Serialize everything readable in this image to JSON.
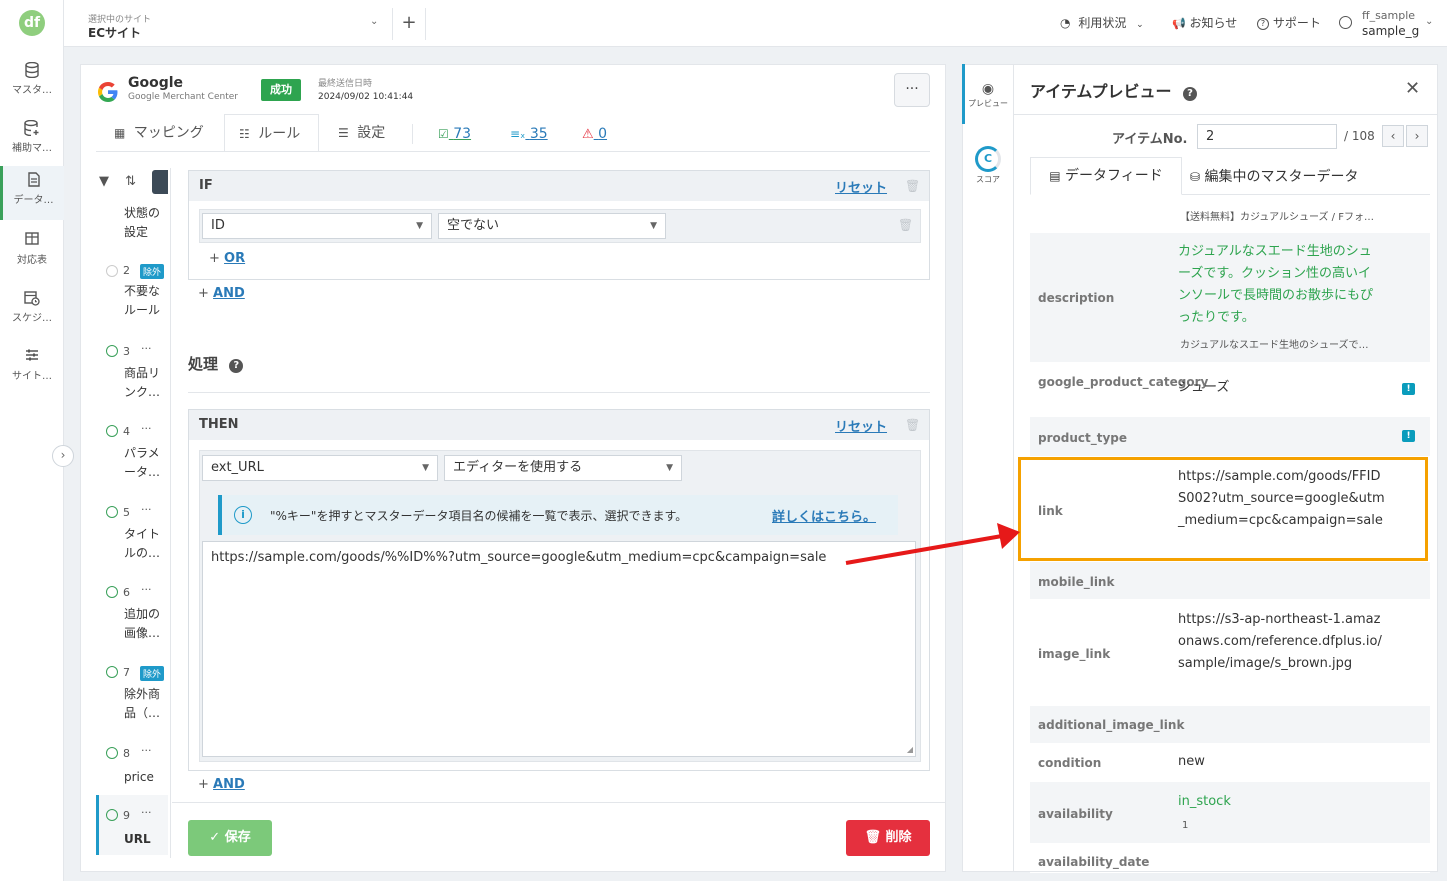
{
  "rail": {
    "logo": "df",
    "items": [
      {
        "label": "マスタ…",
        "icon": "database-icon"
      },
      {
        "label": "補助マ…",
        "icon": "database-plus-icon"
      },
      {
        "label": "データ…",
        "icon": "document-icon"
      },
      {
        "label": "対応表",
        "icon": "table-icon"
      },
      {
        "label": "スケジ…",
        "icon": "calendar-clock-icon"
      },
      {
        "label": "サイト…",
        "icon": "sliders-icon"
      }
    ]
  },
  "header": {
    "site_label": "選択中のサイト",
    "site_name": "ECサイト",
    "usage": "利用状況",
    "news": "お知らせ",
    "support": "サポート",
    "user_id": "ff_sample",
    "user_name": "sample_g"
  },
  "feed": {
    "name": "Google",
    "subtitle": "Google Merchant Center",
    "status": "成功",
    "last_sent_label": "最終送信日時",
    "last_sent": "2024/09/02 10:41:44",
    "more": "···"
  },
  "tabs": {
    "mapping": "マッピング",
    "rules": "ルール",
    "settings": "設定",
    "stat_ok": "73",
    "stat_x": "35",
    "stat_warn": "0"
  },
  "rules": [
    {
      "num": "",
      "name": "状態の設定",
      "tag": ""
    },
    {
      "num": "2",
      "name": "不要なルール",
      "tag": "除外"
    },
    {
      "num": "3",
      "name": "商品リンク…",
      "tag": ""
    },
    {
      "num": "4",
      "name": "パラメータ…",
      "tag": ""
    },
    {
      "num": "5",
      "name": "タイトルの…",
      "tag": ""
    },
    {
      "num": "6",
      "name": "追加の画像…",
      "tag": ""
    },
    {
      "num": "7",
      "name": "除外商品（…",
      "tag": "除外"
    },
    {
      "num": "8",
      "name": "price",
      "tag": ""
    },
    {
      "num": "9",
      "name": "URL",
      "tag": ""
    }
  ],
  "if_box": {
    "title": "IF",
    "reset": "リセット",
    "field": "ID",
    "operator": "空でない",
    "or": "OR",
    "and": "AND"
  },
  "process": {
    "title": "処理"
  },
  "then_box": {
    "title": "THEN",
    "reset": "リセット",
    "field": "ext_URL",
    "mode": "エディターを使用する",
    "info": "\"%キー\"を押すとマスターデータ項目名の候補を一覧で表示、選択できます。",
    "info_link": "詳しくはこちら。",
    "editor_value": "https://sample.com/goods/%%ID%%?utm_source=google&utm_medium=cpc&campaign=sale",
    "and": "AND"
  },
  "footer": {
    "save": "保存",
    "delete": "削除"
  },
  "preview": {
    "rail_preview": "プレビュー",
    "rail_score": "スコア",
    "title": "アイテムプレビュー",
    "item_no_label": "アイテムNo.",
    "item_no": "2",
    "item_total": "/ 108",
    "tab_feed": "データフィード",
    "tab_master": "編集中のマスターデータ",
    "top_sub": "【送料無料】カジュアルシューズ / Fフォ…",
    "rows": [
      {
        "key": "description",
        "value": "カジュアルなスエード生地のシューズです。クッション性の高いインソールで長時間のお散歩にもぴったりです。",
        "sub": "カジュアルなスエード生地のシューズで…"
      },
      {
        "key": "google_product_category",
        "value": "シューズ",
        "sub": ""
      },
      {
        "key": "product_type",
        "value": "",
        "sub": ""
      },
      {
        "key": "link",
        "value": "https://sample.com/goods/FFIDS002?utm_source=google&utm_medium=cpc&campaign=sale",
        "sub": ""
      },
      {
        "key": "mobile_link",
        "value": "",
        "sub": ""
      },
      {
        "key": "image_link",
        "value": "https://s3-ap-northeast-1.amazonaws.com/reference.dfplus.io/sample/image/s_brown.jpg",
        "sub": ""
      },
      {
        "key": "additional_image_link",
        "value": "",
        "sub": ""
      },
      {
        "key": "condition",
        "value": "new",
        "sub": ""
      },
      {
        "key": "availability",
        "value": "in_stock",
        "sub": "1"
      },
      {
        "key": "availability_date",
        "value": "",
        "sub": ""
      }
    ]
  },
  "colors": {
    "accent": "#3aa05a",
    "link": "#2a7ab8",
    "success": "#2ea44f",
    "danger": "#e5303e",
    "highlight": "#f5a100",
    "arrow": "#e61919"
  }
}
